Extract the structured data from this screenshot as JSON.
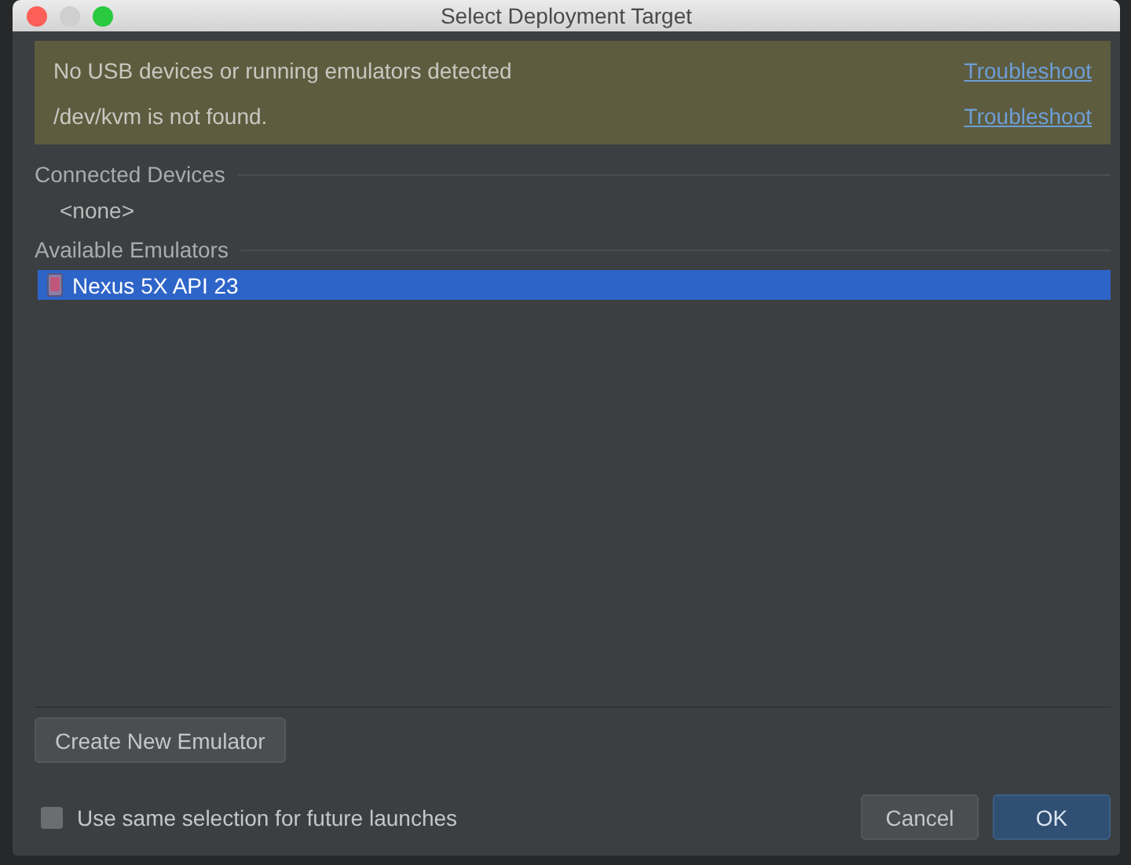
{
  "window": {
    "title": "Select Deployment Target"
  },
  "warnings": [
    {
      "message": "No USB devices or running emulators detected",
      "link": "Troubleshoot"
    },
    {
      "message": "/dev/kvm is not found.",
      "link": "Troubleshoot"
    }
  ],
  "sections": [
    {
      "title": "Connected Devices",
      "items": [
        {
          "label": "<none>",
          "kind": "placeholder",
          "selected": false
        }
      ]
    },
    {
      "title": "Available Emulators",
      "items": [
        {
          "label": "Nexus 5X API 23",
          "kind": "device",
          "selected": true
        }
      ]
    }
  ],
  "create_button": "Create New Emulator",
  "reuse_option": {
    "label": "Use same selection for future launches",
    "checked": false
  },
  "buttons": [
    {
      "label": "Cancel",
      "kind": "secondary"
    },
    {
      "label": "OK",
      "kind": "primary"
    }
  ]
}
